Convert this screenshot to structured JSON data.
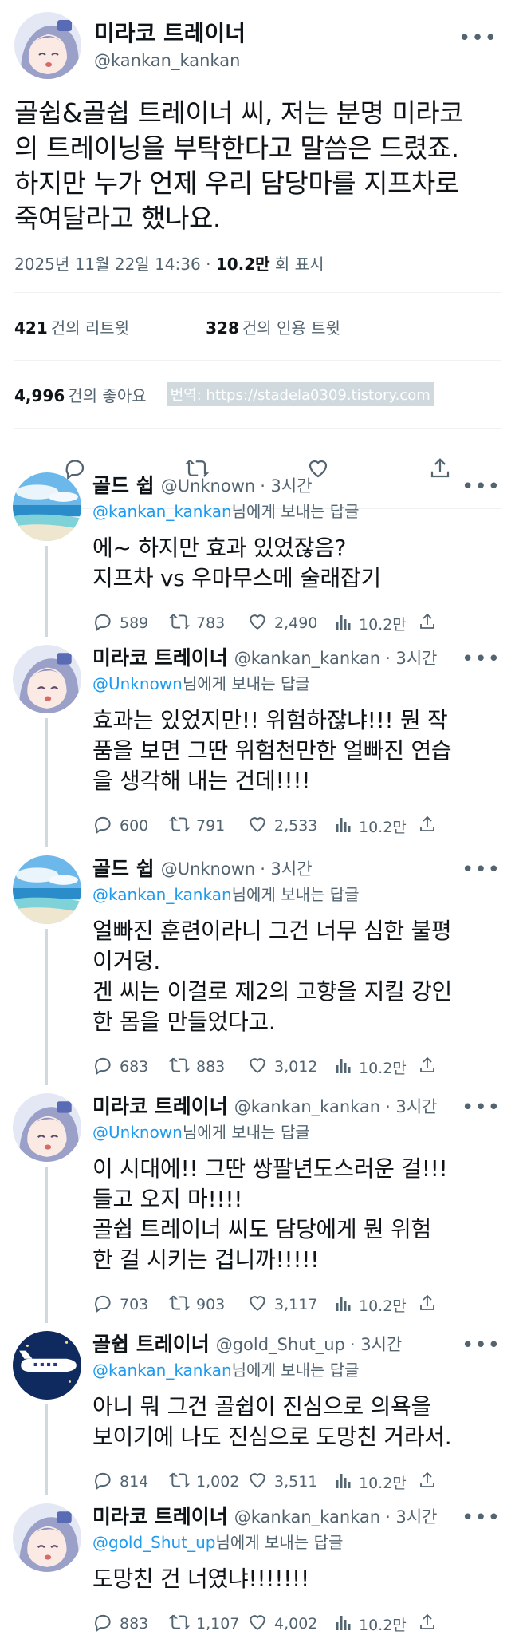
{
  "main_tweet": {
    "name": "미라코 트레이너",
    "handle": "@kankan_kankan",
    "text": "골쉽&골쉽 트레이너 씨, 저는 분명 미라코\n의 트레이닝을 부탁한다고 말씀은 드렸죠.\n하지만 누가 언제 우리 담당마를 지프차로\n죽여달라고 했나요.",
    "datetime": "2025년 11월 22일 14:36",
    "views_count": "10.2만",
    "views_label": "회 표시",
    "retweets_count": "421",
    "retweets_label": "건의 리트윗",
    "quotes_count": "328",
    "quotes_label": "건의 인용 트윗",
    "likes_count": "4,996",
    "likes_label": "건의 좋아요",
    "watermark": "번역: https://stadela0309.tistory.com"
  },
  "replies": [
    {
      "name": "골드 쉽",
      "handle": "@Unknown",
      "time": "· 3시간",
      "reply_to": "@kankan_kankan",
      "reply_to_suffix": "님에게 보내는 답글",
      "text": "에~ 하지만 효과 있었잖음?\n지프차 vs 우마무스메 술래잡기",
      "replies": "589",
      "retweets": "783",
      "likes": "2,490",
      "views": "10.2만"
    },
    {
      "name": "미라코 트레이너",
      "handle": "@kankan_kankan",
      "time": "· 3시간",
      "reply_to": "@Unknown",
      "reply_to_suffix": "님에게 보내는 답글",
      "text": "효과는 있었지만!! 위험하잖냐!!! 뭔 작\n품을 보면 그딴 위험천만한 얼빠진 연습\n을 생각해 내는 건데!!!!",
      "replies": "600",
      "retweets": "791",
      "likes": "2,533",
      "views": "10.2만"
    },
    {
      "name": "골드 쉽",
      "handle": "@Unknown",
      "time": "· 3시간",
      "reply_to": "@kankan_kankan",
      "reply_to_suffix": "님에게 보내는 답글",
      "text": "얼빠진 훈련이라니 그건 너무 심한 불평\n이거덩.\n겐 씨는 이걸로 제2의 고향을 지킬 강인\n한 몸을 만들었다고.",
      "replies": "683",
      "retweets": "883",
      "likes": "3,012",
      "views": "10.2만"
    },
    {
      "name": "미라코 트레이너",
      "handle": "@kankan_kankan",
      "time": "· 3시간",
      "reply_to": "@Unknown",
      "reply_to_suffix": "님에게 보내는 답글",
      "text": "이 시대에!! 그딴 쌍팔년도스러운 걸!!!\n들고 오지 마!!!!\n골쉽 트레이너 씨도 담당에게 뭔 위험\n한 걸 시키는 겁니까!!!!!",
      "replies": "703",
      "retweets": "903",
      "likes": "3,117",
      "views": "10.2만"
    },
    {
      "name": "골쉽 트레이너",
      "handle": "@gold_Shut_up",
      "time": "· 3시간",
      "reply_to": "@kankan_kankan",
      "reply_to_suffix": "님에게 보내는 답글",
      "text": "아니 뭐 그건 골쉽이 진심으로 의욕을\n보이기에 나도 진심으로 도망친 거라서.",
      "replies": "814",
      "retweets": "1,002",
      "likes": "3,511",
      "views": "10.2만"
    },
    {
      "name": "미라코 트레이너",
      "handle": "@kankan_kankan",
      "time": "· 3시간",
      "reply_to": "@gold_Shut_up",
      "reply_to_suffix": "님에게 보내는 답글",
      "text": "도망친 건 너였냐!!!!!!!",
      "replies": "883",
      "retweets": "1,107",
      "likes": "4,002",
      "views": "10.2만"
    }
  ],
  "icons": {
    "reply": "comment-icon",
    "retweet": "retweet-icon",
    "like": "heart-icon",
    "views": "analytics-icon",
    "share": "share-icon",
    "more": "more-dots-icon"
  },
  "colors": {
    "link": "#1d9bf0",
    "secondary_text": "#536471",
    "divider": "#eff3f4",
    "thread_line": "#cfd9de"
  }
}
